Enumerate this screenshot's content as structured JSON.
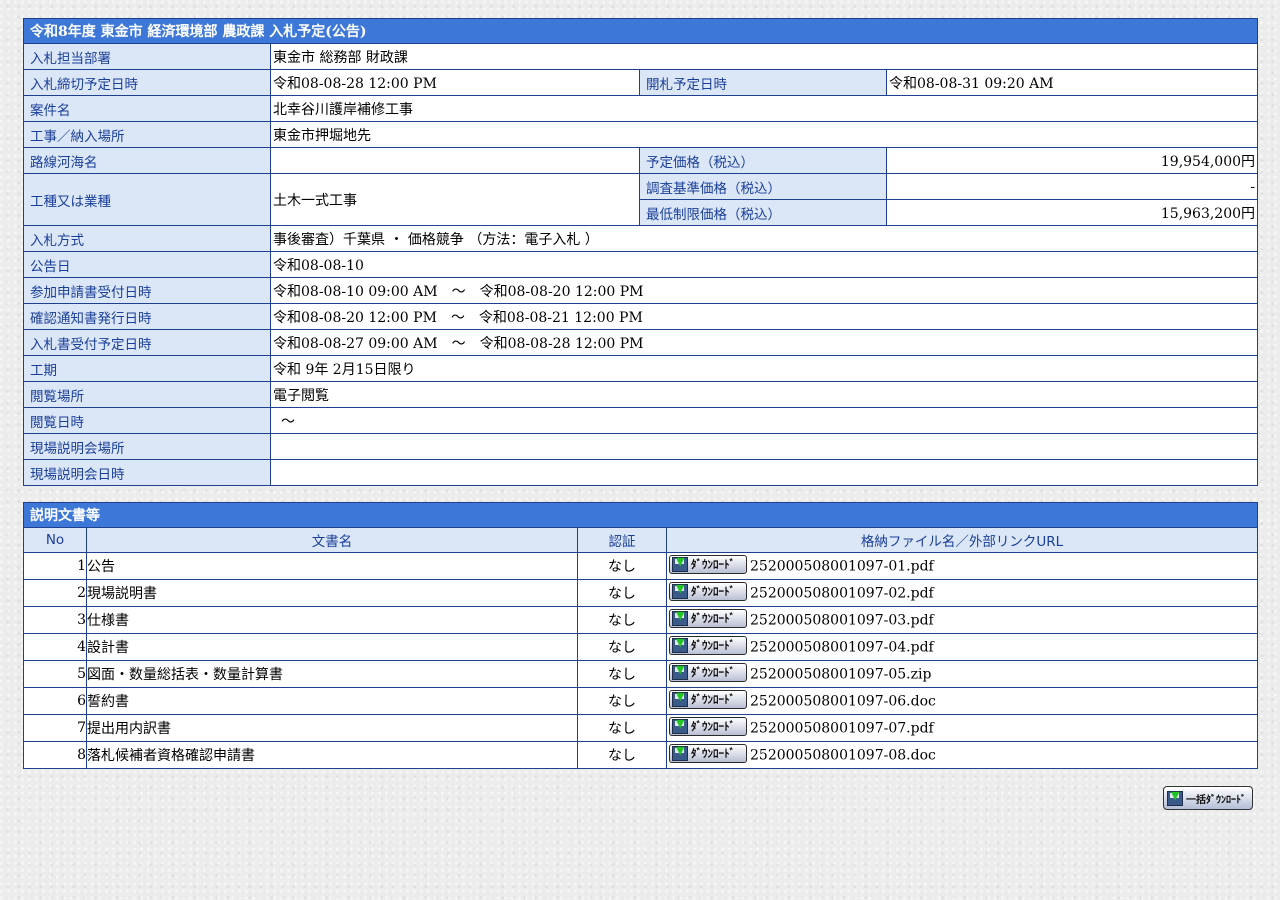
{
  "info": {
    "title": "令和8年度 東金市 経済環境部 農政課 入札予定(公告)",
    "dept_label": "入札担当部署",
    "dept_value": "東金市 総務部 財政課",
    "deadline_label": "入札締切予定日時",
    "deadline_value": "令和08-08-28 12:00 PM",
    "open_label": "開札予定日時",
    "open_value": "令和08-08-31 09:20 AM",
    "case_label": "案件名",
    "case_value": "北幸谷川護岸補修工事",
    "place_label": "工事／納入場所",
    "place_value": "東金市押堀地先",
    "route_label": "路線河海名",
    "route_value": "",
    "price_label": "予定価格（税込）",
    "price_value": "19,954,000円",
    "type_label": "工種又は業種",
    "type_value": "土木一式工事",
    "survey_label": "調査基準価格（税込）",
    "survey_value": "-",
    "min_label": "最低制限価格（税込）",
    "min_value": "15,963,200円",
    "method_label": "入札方式",
    "method_value": "事後審査）千葉県 ・ 価格競争 （方法：電子入札 ）",
    "notice_label": "公告日",
    "notice_value": "令和08-08-10",
    "apply_label": "参加申請書受付日時",
    "apply_value": "令和08-08-10 09:00 AM　～　令和08-08-20 12:00 PM",
    "confirm_label": "確認通知書発行日時",
    "confirm_value": "令和08-08-20 12:00 PM　～　令和08-08-21 12:00 PM",
    "receipt_label": "入札書受付予定日時",
    "receipt_value": "令和08-08-27 09:00 AM　～　令和08-08-28 12:00 PM",
    "period_label": "工期",
    "period_value": "令和 9年 2月15日限り",
    "view_place_label": "閲覧場所",
    "view_place_value": "電子閲覧",
    "view_date_label": "閲覧日時",
    "view_date_value": "～",
    "site_place_label": "現場説明会場所",
    "site_place_value": "",
    "site_date_label": "現場説明会日時",
    "site_date_value": ""
  },
  "docs": {
    "title": "説明文書等",
    "headers": {
      "no": "No",
      "name": "文書名",
      "auth": "認証",
      "file": "格納ファイル名／外部リンクURL"
    },
    "download_label": "ﾀﾞｳﾝﾛｰﾄﾞ",
    "rows": [
      {
        "no": "1",
        "name": "公告",
        "auth": "なし",
        "file": "252000508001097-01.pdf"
      },
      {
        "no": "2",
        "name": "現場説明書",
        "auth": "なし",
        "file": "252000508001097-02.pdf"
      },
      {
        "no": "3",
        "name": "仕様書",
        "auth": "なし",
        "file": "252000508001097-03.pdf"
      },
      {
        "no": "4",
        "name": "設計書",
        "auth": "なし",
        "file": "252000508001097-04.pdf"
      },
      {
        "no": "5",
        "name": "図面・数量総括表・数量計算書",
        "auth": "なし",
        "file": "252000508001097-05.zip"
      },
      {
        "no": "6",
        "name": "誓約書",
        "auth": "なし",
        "file": "252000508001097-06.doc"
      },
      {
        "no": "7",
        "name": "提出用内訳書",
        "auth": "なし",
        "file": "252000508001097-07.pdf"
      },
      {
        "no": "8",
        "name": "落札候補者資格確認申請書",
        "auth": "なし",
        "file": "252000508001097-08.doc"
      }
    ]
  },
  "bulk_download_label": "一括ﾀﾞｳﾝﾛｰﾄﾞ",
  "colors": {
    "header_bg": "#3d78d8",
    "label_bg": "#dbe6f6",
    "label_text": "#1a3f9a",
    "border": "#1f3f8f"
  }
}
